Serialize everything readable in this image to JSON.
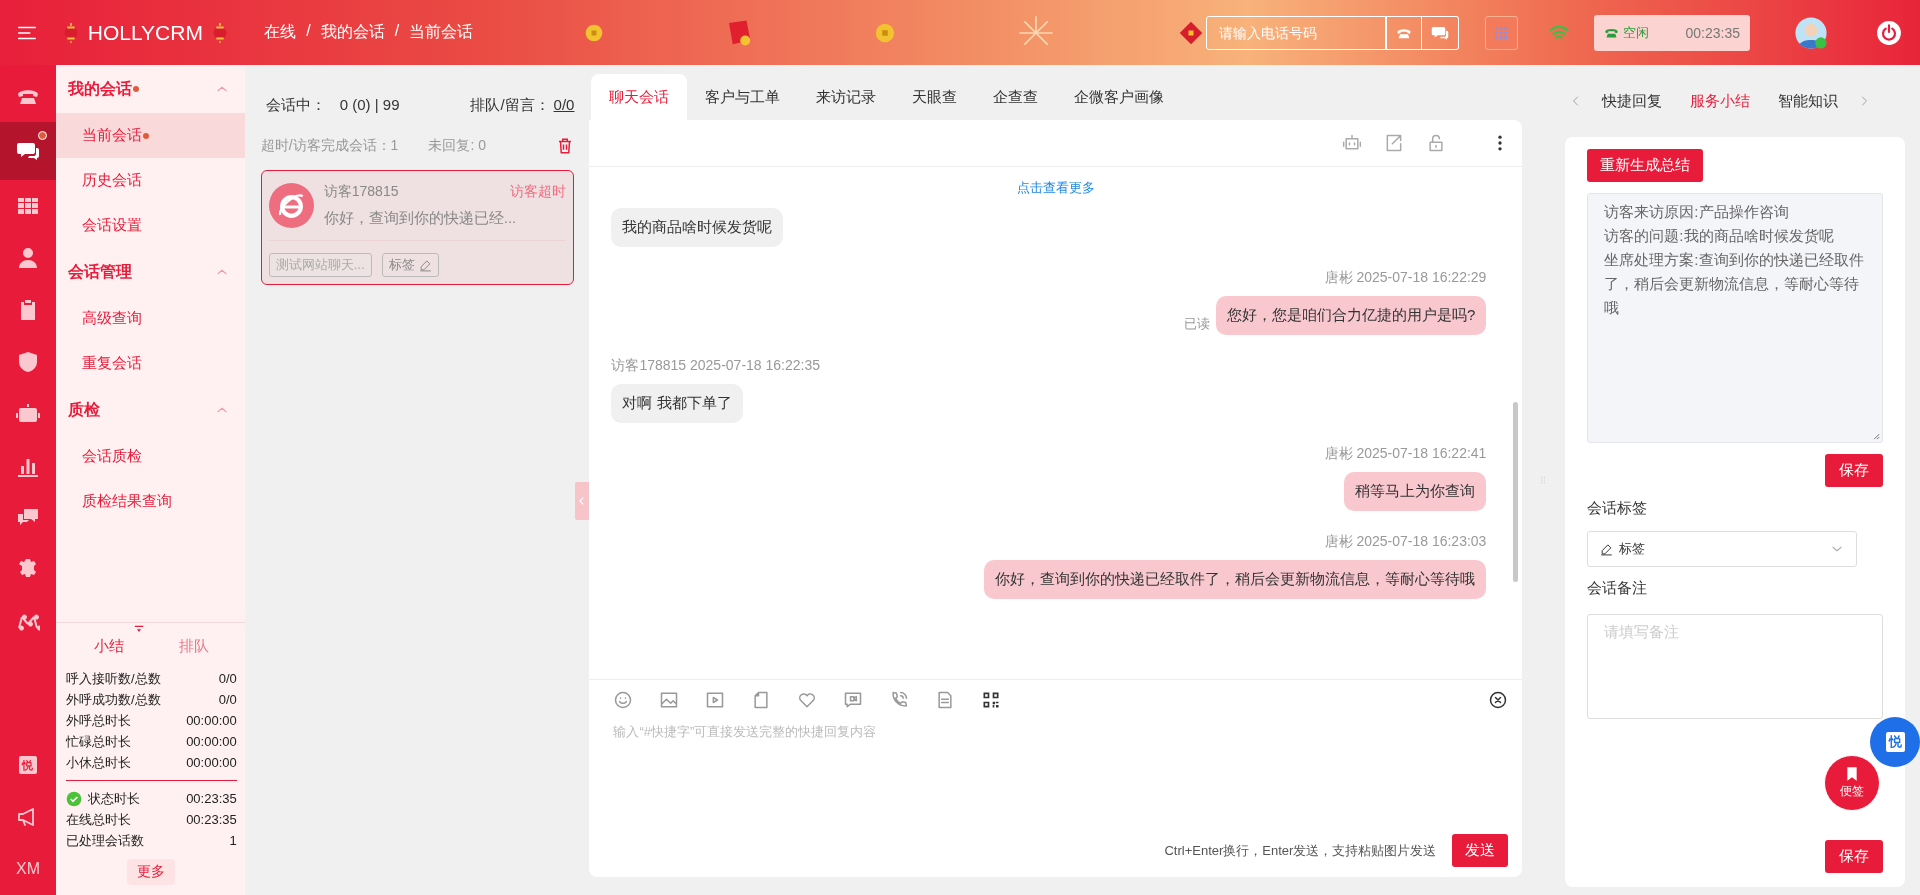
{
  "topbar": {
    "logo": "HOLLYCRM",
    "breadcrumb": [
      "在线",
      "我的会话",
      "当前会话"
    ],
    "breadcrumb_separator": "/",
    "phone_search": {
      "placeholder": "请输入电话号码"
    },
    "status": {
      "label": "空闲",
      "timer": "00:23:35"
    }
  },
  "rail": [
    {
      "kind": "phone",
      "selected": false,
      "dot": false
    },
    {
      "kind": "chat",
      "selected": true,
      "dot": true
    },
    {
      "kind": "grid",
      "selected": false,
      "dot": false
    },
    {
      "kind": "person",
      "selected": false,
      "dot": false
    },
    {
      "kind": "clipboard",
      "selected": false,
      "dot": false
    },
    {
      "kind": "shield",
      "selected": false,
      "dot": false
    },
    {
      "kind": "robot",
      "selected": false,
      "dot": false
    },
    {
      "kind": "chart",
      "selected": false,
      "dot": false
    },
    {
      "kind": "messages",
      "selected": false,
      "dot": false
    },
    {
      "kind": "gear",
      "selected": false,
      "dot": false
    },
    {
      "kind": "network",
      "selected": false,
      "dot": false
    }
  ],
  "rail_bottom": [
    {
      "kind": "tile",
      "label": "悦"
    },
    {
      "kind": "megaphone"
    },
    {
      "kind": "text",
      "label": "XM"
    }
  ],
  "nav": [
    {
      "label": "我的会话",
      "dot": true,
      "expanded": true,
      "children": [
        {
          "label": "当前会话",
          "selected": true,
          "dot": true
        },
        {
          "label": "历史会话",
          "selected": false,
          "dot": false
        },
        {
          "label": "会话设置",
          "selected": false,
          "dot": false
        }
      ]
    },
    {
      "label": "会话管理",
      "dot": false,
      "expanded": true,
      "children": [
        {
          "label": "高级查询",
          "selected": false,
          "dot": false
        },
        {
          "label": "重复会话",
          "selected": false,
          "dot": false
        }
      ]
    },
    {
      "label": "质检",
      "dot": false,
      "expanded": true,
      "children": [
        {
          "label": "会话质检",
          "selected": false,
          "dot": false
        },
        {
          "label": "质检结果查询",
          "selected": false,
          "dot": false
        }
      ]
    }
  ],
  "summary": {
    "tabs": [
      {
        "label": "小结",
        "selected": true
      },
      {
        "label": "排队",
        "selected": false
      }
    ],
    "rows": [
      {
        "label": "呼入接听数/总数",
        "value": "0/0"
      },
      {
        "label": "外呼成功数/总数",
        "value": "0/0"
      },
      {
        "label": "外呼总时长",
        "value": "00:00:00"
      },
      {
        "label": "忙碌总时长",
        "value": "00:00:00"
      },
      {
        "label": "小休总时长",
        "value": "00:00:00"
      }
    ],
    "status_rows": [
      {
        "label": "状态时长",
        "value": "00:23:35",
        "ok": true
      },
      {
        "label": "在线总时长",
        "value": "00:23:35",
        "ok": false
      },
      {
        "label": "已处理会话数",
        "value": "1",
        "ok": false
      }
    ],
    "more": "更多"
  },
  "conversations": {
    "active_label": "会话中：",
    "active_value": "0 (0) | 99",
    "queue_label": "排队/留言：",
    "queue_value": "0/0",
    "finished": "超时/访客完成会话：1",
    "unreplied": "未回复: 0",
    "items": [
      {
        "name": "访客178815",
        "status": "访客超时",
        "preview": "你好，查询到你的快递已经...",
        "source": "测试网站聊天...",
        "tag": "标签",
        "selected": true
      }
    ]
  },
  "chat": {
    "tabs": [
      {
        "label": "聊天会话",
        "selected": true
      },
      {
        "label": "客户与工单",
        "selected": false
      },
      {
        "label": "来访记录",
        "selected": false
      },
      {
        "label": "天眼查",
        "selected": false
      },
      {
        "label": "企查查",
        "selected": false
      },
      {
        "label": "企微客户画像",
        "selected": false
      }
    ],
    "load_more": "点击查看更多",
    "messages": [
      {
        "kind": "visitor",
        "text": "我的商品啥时候发货呢"
      },
      {
        "kind": "agent",
        "meta": "唐彬 2025-07-18 16:22:29",
        "text": "您好，您是咱们合力亿捷的用户是吗?",
        "read": "已读"
      },
      {
        "kind": "visitor",
        "meta": "访客178815 2025-07-18 16:22:35",
        "text": "对啊 我都下单了"
      },
      {
        "kind": "agent",
        "meta": "唐彬 2025-07-18 16:22:41",
        "text": "稍等马上为你查询"
      },
      {
        "kind": "agent",
        "meta": "唐彬 2025-07-18 16:23:03",
        "text": "你好，查询到你的快递已经取件了，稍后会更新物流信息，等耐心等待哦"
      }
    ],
    "input": {
      "placeholder": "输入“#快捷字”可直接发送完整的快捷回复内容"
    },
    "hint": "Ctrl+Enter换行，Enter发送，支持粘贴图片发送",
    "send": "发送"
  },
  "side": {
    "tabs": [
      {
        "label": "快捷回复",
        "selected": false
      },
      {
        "label": "服务小结",
        "selected": true
      },
      {
        "label": "智能知识",
        "selected": false
      }
    ],
    "regenerate": "重新生成总结",
    "summary_lines": [
      "访客来访原因:产品操作咨询",
      "访客的问题:我的商品啥时候发货呢",
      "坐席处理方案:查询到你的快递已经取件了，稍后会更新物流信息，等耐心等待哦"
    ],
    "save": "保存",
    "tag_label": "会话标签",
    "tag_select": "标签",
    "note_label": "会话备注",
    "note": {
      "placeholder": "请填写备注"
    },
    "save_bottom": "保存",
    "float_tile": "悦",
    "float_note": "便签"
  }
}
